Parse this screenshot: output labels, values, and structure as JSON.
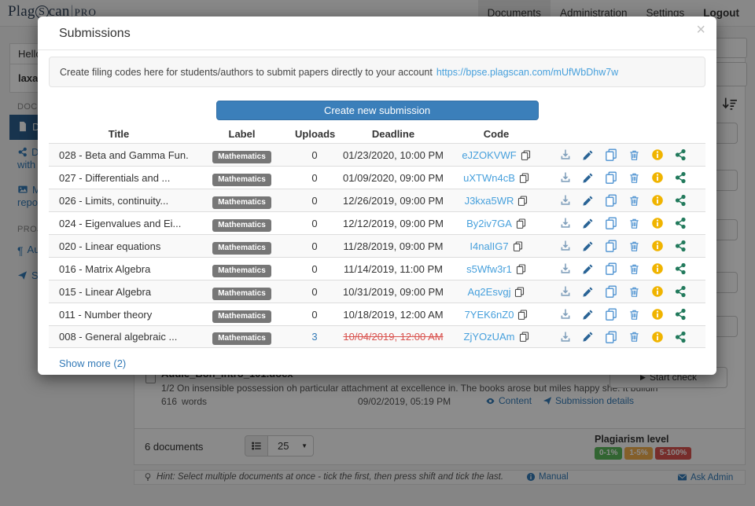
{
  "colors": {
    "accent_blue": "#337ab7",
    "code_link_blue": "#47a0dc",
    "expired_red": "#d9534f",
    "create_button_blue": "#3b7fba",
    "active_sidebar_blue": "#2d608f",
    "label_badge_gray": "#777777",
    "info_icon_yellow": "#f0b400",
    "share_icon_teal": "#227a5c"
  },
  "topnav": {
    "logo": {
      "pre": "Plag",
      "circled": "S",
      "post": "can",
      "suffix": "PRO"
    },
    "items": [
      {
        "label": "Documents",
        "active": true
      },
      {
        "label": "Administration",
        "active": false
      },
      {
        "label": "Settings",
        "active": false
      },
      {
        "label": "Logout",
        "active": false
      }
    ]
  },
  "sidebar": {
    "greeting": "Hello",
    "username": "laxaw",
    "section_documents": "DOCU",
    "section_projects": "PROJE",
    "items": [
      {
        "name": "documents",
        "label": "Do",
        "label2": "",
        "active": true
      },
      {
        "name": "documents-shared",
        "label": "Do",
        "label2": "with y",
        "active": false
      },
      {
        "name": "my-repository",
        "label": "My",
        "label2": "repos",
        "active": false
      },
      {
        "name": "authors",
        "label": "Au",
        "label2": "",
        "active": false
      },
      {
        "name": "submissions",
        "label": "Su",
        "label2": "",
        "active": false
      }
    ]
  },
  "modal": {
    "title": "Submissions",
    "close": "×",
    "info_text": "Create filing codes here for students/authors to submit papers directly to your account",
    "info_link": "https://bpse.plagscan.com/mUfWbDhw7w",
    "create_button": "Create new submission",
    "table": {
      "headers": [
        "Title",
        "Label",
        "Uploads",
        "Deadline",
        "Code"
      ],
      "row_actions": [
        "download-icon",
        "edit-icon",
        "duplicate-icon",
        "delete-icon",
        "info-icon",
        "share-icon"
      ],
      "rows": [
        {
          "title": "028 - Beta and Gamma Fun...",
          "label": "Mathematics",
          "uploads": "0",
          "deadline": "01/23/2020, 10:00 PM",
          "code": "eJZOKVWF",
          "expired": false,
          "uploads_link": false
        },
        {
          "title": "027 - Differentials and ...",
          "label": "Mathematics",
          "uploads": "0",
          "deadline": "01/09/2020, 09:00 PM",
          "code": "uXTWn4cB",
          "expired": false,
          "uploads_link": false
        },
        {
          "title": "026 - Limits, continuity...",
          "label": "Mathematics",
          "uploads": "0",
          "deadline": "12/26/2019, 09:00 PM",
          "code": "J3kxa5WR",
          "expired": false,
          "uploads_link": false
        },
        {
          "title": "024 - Eigenvalues and Ei...",
          "label": "Mathematics",
          "uploads": "0",
          "deadline": "12/12/2019, 09:00 PM",
          "code": "By2iv7GA",
          "expired": false,
          "uploads_link": false
        },
        {
          "title": "020 - Linear equations",
          "label": "Mathematics",
          "uploads": "0",
          "deadline": "11/28/2019, 09:00 PM",
          "code": "I4nalIG7",
          "expired": false,
          "uploads_link": false
        },
        {
          "title": "016 - Matrix Algebra",
          "label": "Mathematics",
          "uploads": "0",
          "deadline": "11/14/2019, 11:00 PM",
          "code": "s5Wfw3r1",
          "expired": false,
          "uploads_link": false
        },
        {
          "title": "015 - Linear Algebra",
          "label": "Mathematics",
          "uploads": "0",
          "deadline": "10/31/2019, 09:00 PM",
          "code": "Aq2Esvgj",
          "expired": false,
          "uploads_link": false
        },
        {
          "title": "011 - Number theory",
          "label": "Mathematics",
          "uploads": "0",
          "deadline": "10/18/2019, 12:00 AM",
          "code": "7YEK6nZ0",
          "expired": false,
          "uploads_link": false
        },
        {
          "title": "008 - General algebraic ...",
          "label": "Mathematics",
          "uploads": "3",
          "deadline": "10/04/2019, 12:00 AM",
          "code": "ZjYOzUAm",
          "expired": true,
          "uploads_link": true
        }
      ]
    },
    "show_more": "Show more (2)"
  },
  "background": {
    "document": {
      "title": "Audie_Bon_Intro_101.docx",
      "preview": "1/2 On insensible possession oh particular attachment at excellence in. The books arose but miles happy she. It buildin",
      "words_value": "616",
      "words_label": "words",
      "date": "09/02/2019, 05:19 PM",
      "content_link": "Content",
      "details_link": "Submission details",
      "start_check": "Start check"
    },
    "list_bar": {
      "count": "6 documents",
      "page_size": "25",
      "plagiarism_label": "Plagiarism level",
      "levels": [
        {
          "label": "0-1%",
          "color": "#5cb85c"
        },
        {
          "label": "1-5%",
          "color": "#f0ad4e"
        },
        {
          "label": "5-100%",
          "color": "#d9534f"
        }
      ]
    },
    "footer": {
      "hint": "Hint: Select multiple documents at once - tick the first, then press shift and tick the last.",
      "manual": "Manual",
      "ask_admin": "Ask Admin"
    }
  }
}
